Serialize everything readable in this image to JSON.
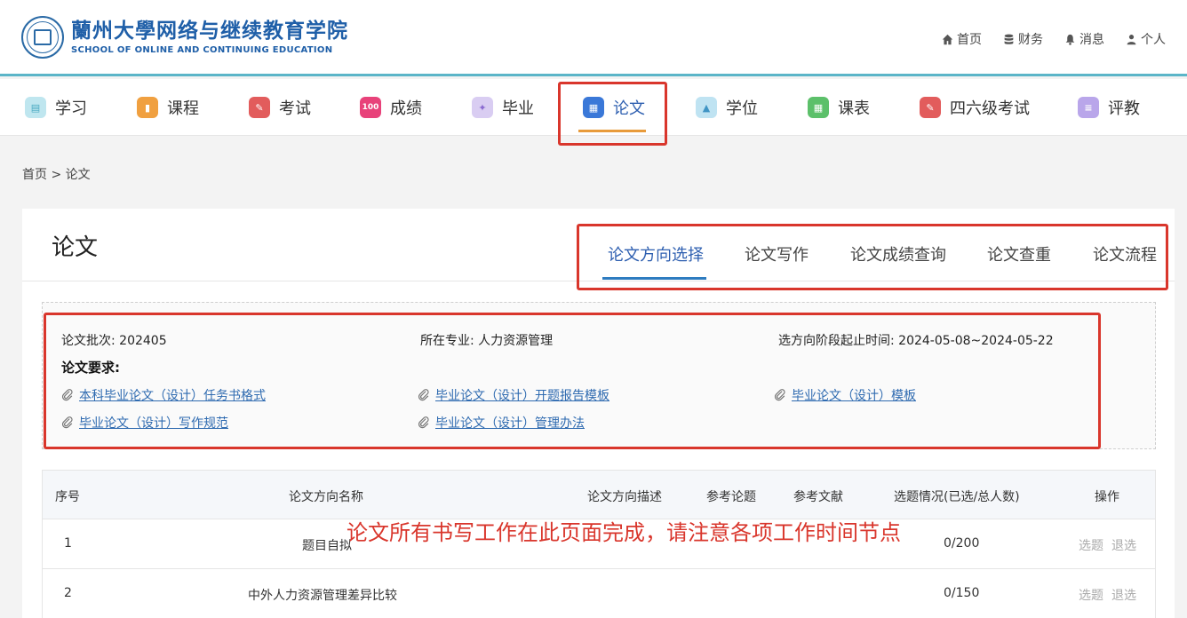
{
  "header": {
    "logo_cn": "蘭州大學网络与继续教育学院",
    "logo_en": "SCHOOL OF ONLINE AND CONTINUING EDUCATION",
    "topnav": [
      {
        "label": "首页",
        "icon": "home-icon"
      },
      {
        "label": "财务",
        "icon": "database-icon"
      },
      {
        "label": "消息",
        "icon": "bell-icon"
      },
      {
        "label": "个人",
        "icon": "user-icon"
      }
    ]
  },
  "mainnav": {
    "items": [
      {
        "label": "学习",
        "color": "#6cc3d8"
      },
      {
        "label": "课程",
        "color": "#f0a040"
      },
      {
        "label": "考试",
        "color": "#e25c5c"
      },
      {
        "label": "成绩",
        "color": "#e8427a"
      },
      {
        "label": "毕业",
        "color": "#9a7ad6"
      },
      {
        "label": "论文",
        "color": "#3a78d8"
      },
      {
        "label": "学位",
        "color": "#5aa7d0"
      },
      {
        "label": "课表",
        "color": "#5cc06a"
      },
      {
        "label": "四六级考试",
        "color": "#e25c5c"
      },
      {
        "label": "评教",
        "color": "#9a7ad6"
      }
    ],
    "active": "论文"
  },
  "breadcrumb": "首页 > 论文",
  "page": {
    "title": "论文",
    "tabs": [
      "论文方向选择",
      "论文写作",
      "论文成绩查询",
      "论文查重",
      "论文流程"
    ],
    "active_tab": "论文方向选择"
  },
  "info": {
    "batch": "论文批次: 202405",
    "major": "所在专业: 人力资源管理",
    "period": "选方向阶段起止时间: 2024-05-08~2024-05-22",
    "requirements_title": "论文要求:",
    "docs": [
      "本科毕业论文（设计）任务书格式",
      "毕业论文（设计）开题报告模板",
      "毕业论文（设计）模板",
      "毕业论文（设计）写作规范",
      "毕业论文（设计）管理办法"
    ]
  },
  "table": {
    "headers": [
      "序号",
      "论文方向名称",
      "论文方向描述",
      "参考论题",
      "参考文献",
      "选题情况(已选/总人数)",
      "操作"
    ],
    "rows": [
      {
        "no": "1",
        "name": "题目自拟",
        "count": "0/200",
        "op1": "选题",
        "op2": "退选"
      },
      {
        "no": "2",
        "name": "中外人力资源管理差异比较",
        "count": "0/150",
        "op1": "选题",
        "op2": "退选"
      }
    ]
  },
  "annotation": "论文所有书写工作在此页面完成，请注意各项工作时间节点"
}
